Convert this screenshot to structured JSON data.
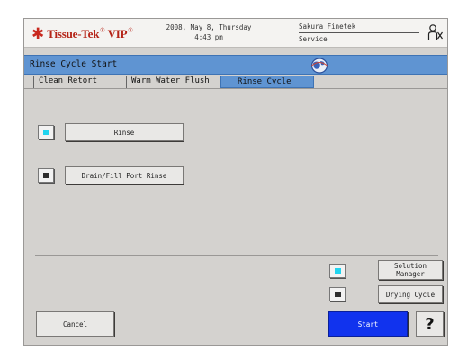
{
  "header": {
    "brand": "Tissue-Tek",
    "brand_suffix": "VIP",
    "date": "2008, May 8, Thursday",
    "time": "4:43 pm",
    "user_name": "Sakura Finetek",
    "user_role": "Service",
    "logout_icon": "person-exit-icon"
  },
  "titlebar": {
    "title": "Rinse Cycle Start",
    "globe_icon": "globe-icon"
  },
  "tabs": [
    {
      "label": "Clean Retort",
      "active": false
    },
    {
      "label": "Warm Water Flush",
      "active": false
    },
    {
      "label": "Rinse Cycle",
      "active": true
    }
  ],
  "main": {
    "rinse_label": "Rinse",
    "rinse_indicator": "cyan",
    "drain_label": "Drain/Fill Port Rinse",
    "drain_indicator": "dark"
  },
  "options": {
    "solution_manager_line1": "Solution",
    "solution_manager_line2": "Manager",
    "solution_indicator": "cyan",
    "drying_cycle_label": "Drying Cycle",
    "drying_indicator": "dark"
  },
  "footer": {
    "cancel_label": "Cancel",
    "start_label": "Start",
    "help_label": "?"
  },
  "colors": {
    "accent_blue": "#5f94d2",
    "start_blue": "#1133ee",
    "indicator_cyan": "#20d4ef",
    "brand_red": "#b52418"
  }
}
